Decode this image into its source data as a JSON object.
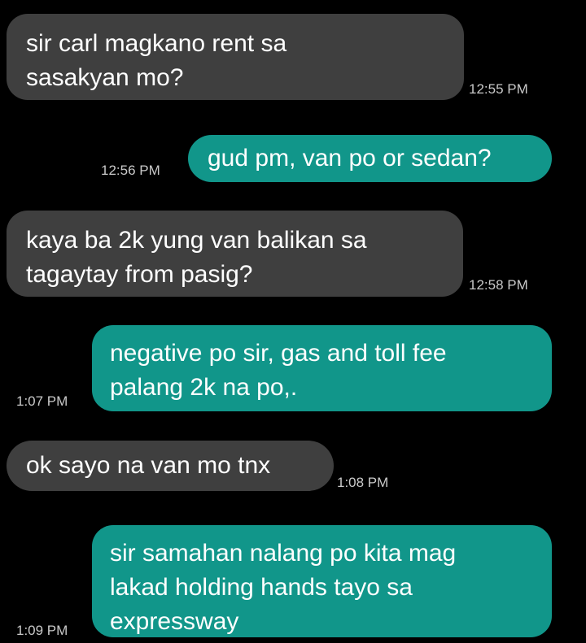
{
  "conversation": {
    "messages": [
      {
        "direction": "incoming",
        "text": "sir carl magkano rent sa\nsasakyan mo?",
        "time": "12:55 PM"
      },
      {
        "direction": "outgoing",
        "text": "gud pm, van po or sedan?",
        "time": "12:56 PM"
      },
      {
        "direction": "incoming",
        "text": "kaya ba 2k yung van balikan sa\ntagaytay from pasig?",
        "time": "12:58 PM"
      },
      {
        "direction": "outgoing",
        "text": "negative po sir, gas and toll fee\npalang 2k na po,.",
        "time": "1:07 PM"
      },
      {
        "direction": "incoming",
        "text": "ok sayo na van mo tnx",
        "time": "1:08 PM"
      },
      {
        "direction": "outgoing",
        "text": "sir samahan nalang po kita mag\nlakad holding hands tayo sa\nexpressway",
        "time": "1:09 PM"
      }
    ]
  },
  "colors": {
    "background": "#000000",
    "incoming_bubble": "#3f3f3f",
    "outgoing_bubble": "#11968a",
    "message_text": "#ffffff",
    "timestamp_text": "#c9c9c9"
  }
}
